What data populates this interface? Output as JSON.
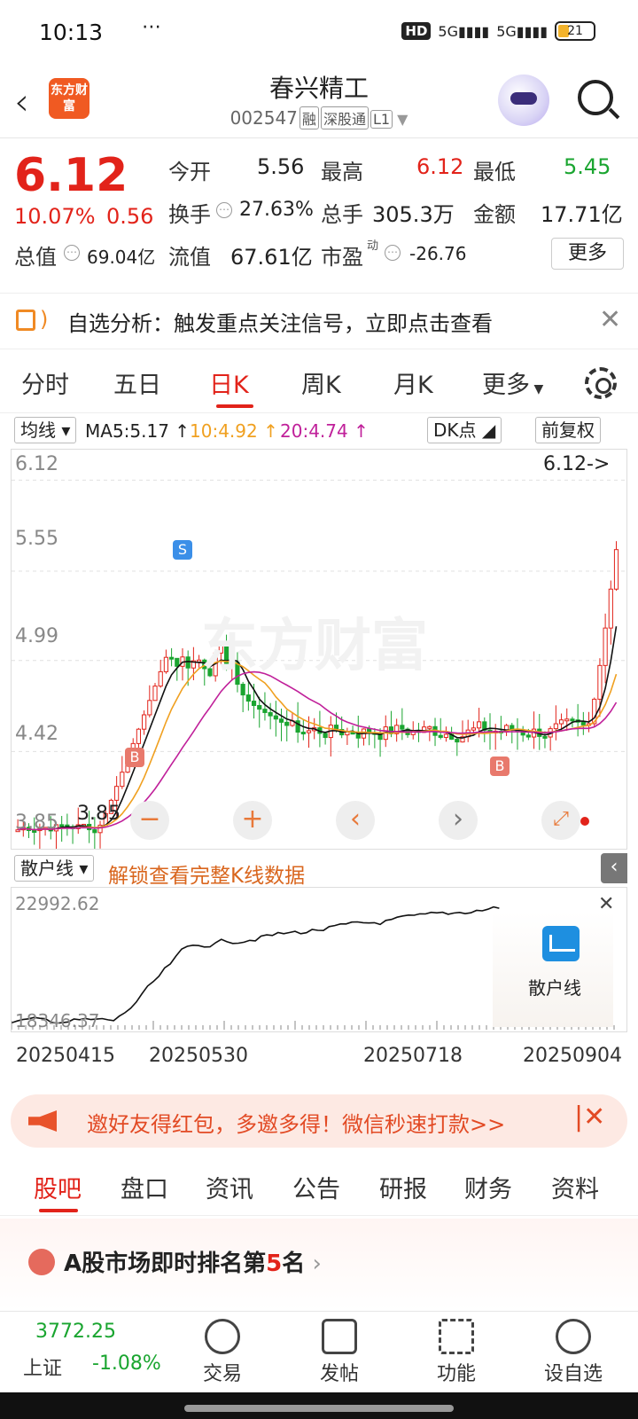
{
  "status": {
    "time": "10:13",
    "battery": "21"
  },
  "header": {
    "title": "春兴精工",
    "code": "002547",
    "tags": [
      "融",
      "深股通",
      "L1"
    ],
    "logo_text": "东方财富"
  },
  "quote": {
    "price": "6.12",
    "change_pct": "10.07%",
    "change": "0.56",
    "open_label": "今开",
    "open": "5.56",
    "high_label": "最高",
    "high": "6.12",
    "low_label": "最低",
    "low": "5.45",
    "turnover_label": "换手",
    "turnover": "27.63%",
    "volume_label": "总手",
    "volume": "305.3万",
    "amount_label": "金额",
    "amount": "17.71亿",
    "mcap_label": "总值",
    "mcap": "69.04亿",
    "float_label": "流值",
    "float": "67.61亿",
    "pe_label": "市盈",
    "pe_sup": "动",
    "pe": "-26.76",
    "more": "更多"
  },
  "notice": {
    "text": "自选分析：触发重点关注信号，立即点击查看"
  },
  "period_tabs": [
    "分时",
    "五日",
    "日K",
    "周K",
    "月K",
    "更多"
  ],
  "ma_row": {
    "select": "均线",
    "ma5": "MA5:5.17",
    "ma10": "10:4.92",
    "ma20": "20:4.74",
    "dk": "DK点",
    "adjust": "前复权"
  },
  "colors": {
    "red": "#e2231a",
    "green": "#1aa530",
    "ma10": "#f0a020",
    "ma20": "#c0209a"
  },
  "chart": {
    "y_labels": [
      "6.12",
      "5.55",
      "4.99",
      "4.42",
      "3.85"
    ],
    "last_marker": "6.12->",
    "low_label": "3.85",
    "signal_s": "S",
    "signal_b": "B",
    "watermark": "东方财富"
  },
  "indicator": {
    "select": "散户线",
    "unlock_text": "解锁查看完整K线数据",
    "y_top": "22992.62",
    "y_bottom": "18346.37",
    "card_label": "散户线",
    "dates": [
      "20250415",
      "20250530",
      "20250718",
      "20250904"
    ]
  },
  "invite": {
    "text": "邀好友得红包，多邀多得！微信秒速打款>>"
  },
  "bottom_tabs": [
    "股吧",
    "盘口",
    "资讯",
    "公告",
    "研报",
    "财务",
    "资料"
  ],
  "rank": {
    "prefix": "A股市场即时排名第",
    "num": "5",
    "suffix": "名"
  },
  "footer": {
    "index_value": "3772.25",
    "index_name": "上证",
    "index_change": "-1.08%",
    "items": [
      "交易",
      "发帖",
      "功能",
      "设自选"
    ]
  }
}
